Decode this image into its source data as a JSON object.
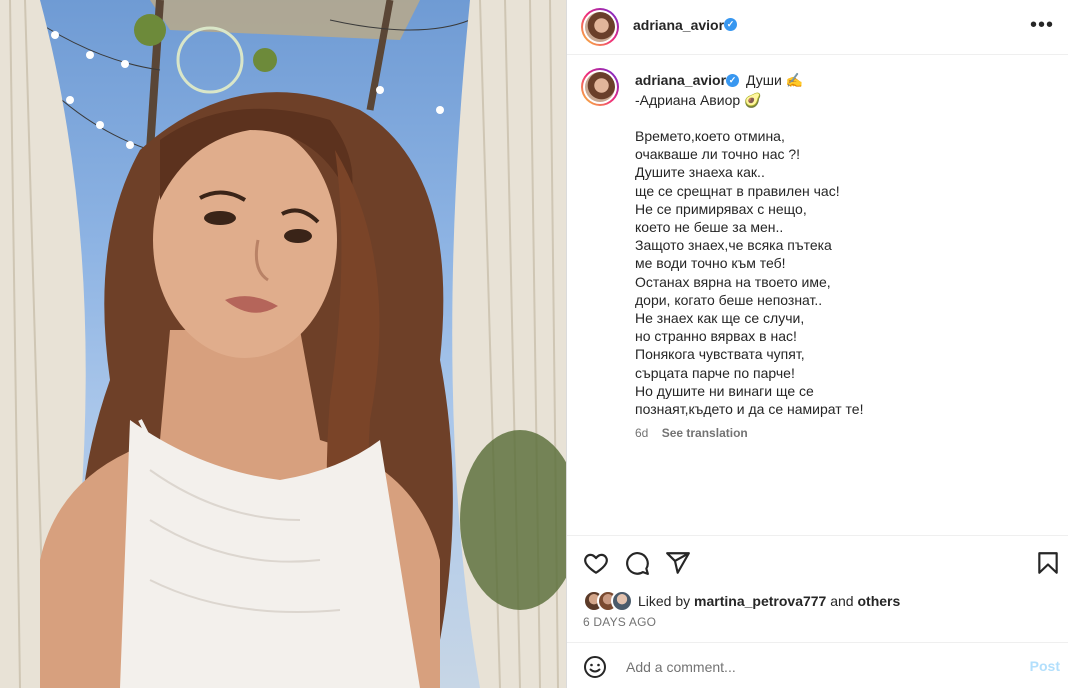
{
  "header": {
    "username": "adriana_avior"
  },
  "caption": {
    "username": "adriana_avior",
    "title": "Души ✍️",
    "subtitle": "-Адриана Авиор 🥑",
    "poem_lines": [
      "Времето,което отмина,",
      "очакваше ли точно нас ?!",
      "Душите знаеха как..",
      "ще се срещнат в правилен час!",
      "Не се примирявах с нещо,",
      "което не беше за мен..",
      "Защото знаех,че всяка пътека",
      "ме води точно към теб!",
      "Останах вярна на твоето име,",
      "дори, когато беше непознат..",
      "Не знаех как ще се случи,",
      "но странно вярвах в нас!",
      "Понякога чувствата чупят,",
      "сърцата парче по парче!",
      "Но душите ни винаги ще се",
      "познаят,където и да се намират те!"
    ],
    "age": "6d",
    "see_translation": "See translation"
  },
  "likes": {
    "prefix": "Liked by",
    "user": "martina_petrova777",
    "joiner": "and",
    "others": "others"
  },
  "posted_ago": "6 DAYS AGO",
  "comment": {
    "placeholder": "Add a comment...",
    "post_label": "Post"
  },
  "icons": {
    "like": "heart-icon",
    "comment": "comment-icon",
    "share": "share-icon",
    "save": "bookmark-icon",
    "more": "more-icon",
    "emoji": "emoji-icon",
    "verified": "verified-badge-icon"
  },
  "colors": {
    "verified": "#3897f0",
    "post_disabled": "#b2dffc",
    "muted": "#737373"
  }
}
